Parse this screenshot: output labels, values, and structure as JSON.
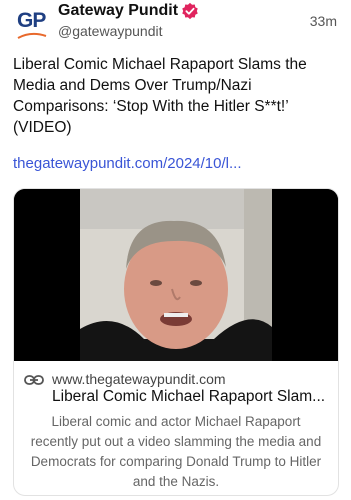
{
  "header": {
    "avatar_text": "GP",
    "name": "Gateway Pundit",
    "handle": "@gatewaypundit",
    "time": "33m",
    "verified_icon": "verified-badge-icon",
    "brand_color": "#1f3f82",
    "accent_color": "#e8692c"
  },
  "post": {
    "text": "Liberal Comic Michael Rapaport Slams the Media and Dems Over Trump/Nazi Comparisons: ‘Stop With the Hitler S**t!’ (VIDEO)",
    "link": "thegatewaypundit.com/2024/10/l...",
    "link_color": "#3a55d6"
  },
  "card": {
    "icon": "link-icon",
    "domain": "www.thegatewaypundit.com",
    "title": "Liberal Comic Michael Rapaport Slam...",
    "description": "Liberal comic and actor Michael Rapaport recently put out a video slamming the media and Democrats for comparing Donald Trump to Hitler and the Nazis."
  }
}
